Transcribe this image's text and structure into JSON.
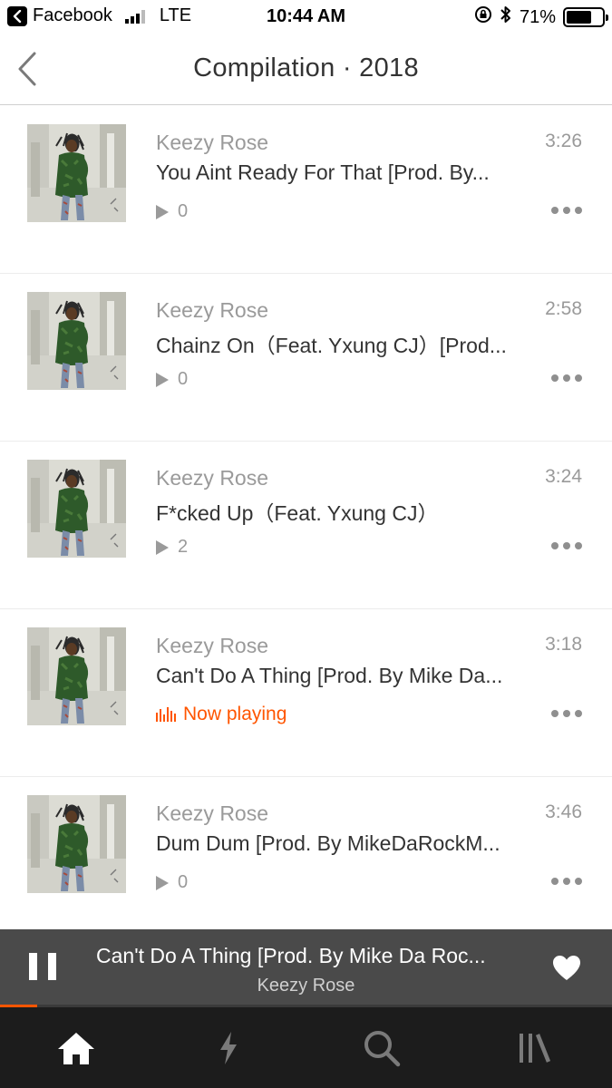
{
  "status_bar": {
    "back_app": "Facebook",
    "network": "LTE",
    "time": "10:44 AM",
    "battery": "71%",
    "battery_level": 0.71
  },
  "header": {
    "title": "Compilation · 2018"
  },
  "tracks": [
    {
      "artist": "Keezy Rose",
      "title": "You Aint Ready For That [Prod. By...",
      "duration": "3:26",
      "plays": "0"
    },
    {
      "artist": "Keezy Rose",
      "title": "Chainz On（Feat. Yxung CJ）[Prod...",
      "duration": "2:58",
      "plays": "0"
    },
    {
      "artist": "Keezy Rose",
      "title": "F*cked Up（Feat. Yxung CJ）",
      "duration": "3:24",
      "plays": "2"
    },
    {
      "artist": "Keezy Rose",
      "title": "Can't Do A Thing [Prod. By Mike Da...",
      "duration": "3:18",
      "now_playing": "Now playing"
    },
    {
      "artist": "Keezy Rose",
      "title": "Dum Dum [Prod. By MikeDaRockM...",
      "duration": "3:46",
      "plays": "0"
    }
  ],
  "mini_player": {
    "title": "Can't Do A Thing [Prod. By Mike Da Roc...",
    "artist": "Keezy Rose",
    "progress": 0.06
  },
  "colors": {
    "accent": "#ff5500",
    "player_bg": "#4a4a4a",
    "tab_bar_bg": "#1c1c1c"
  },
  "tabs": [
    {
      "icon": "home-icon",
      "active": true
    },
    {
      "icon": "lightning-icon",
      "active": false
    },
    {
      "icon": "search-icon",
      "active": false
    },
    {
      "icon": "library-icon",
      "active": false
    }
  ]
}
